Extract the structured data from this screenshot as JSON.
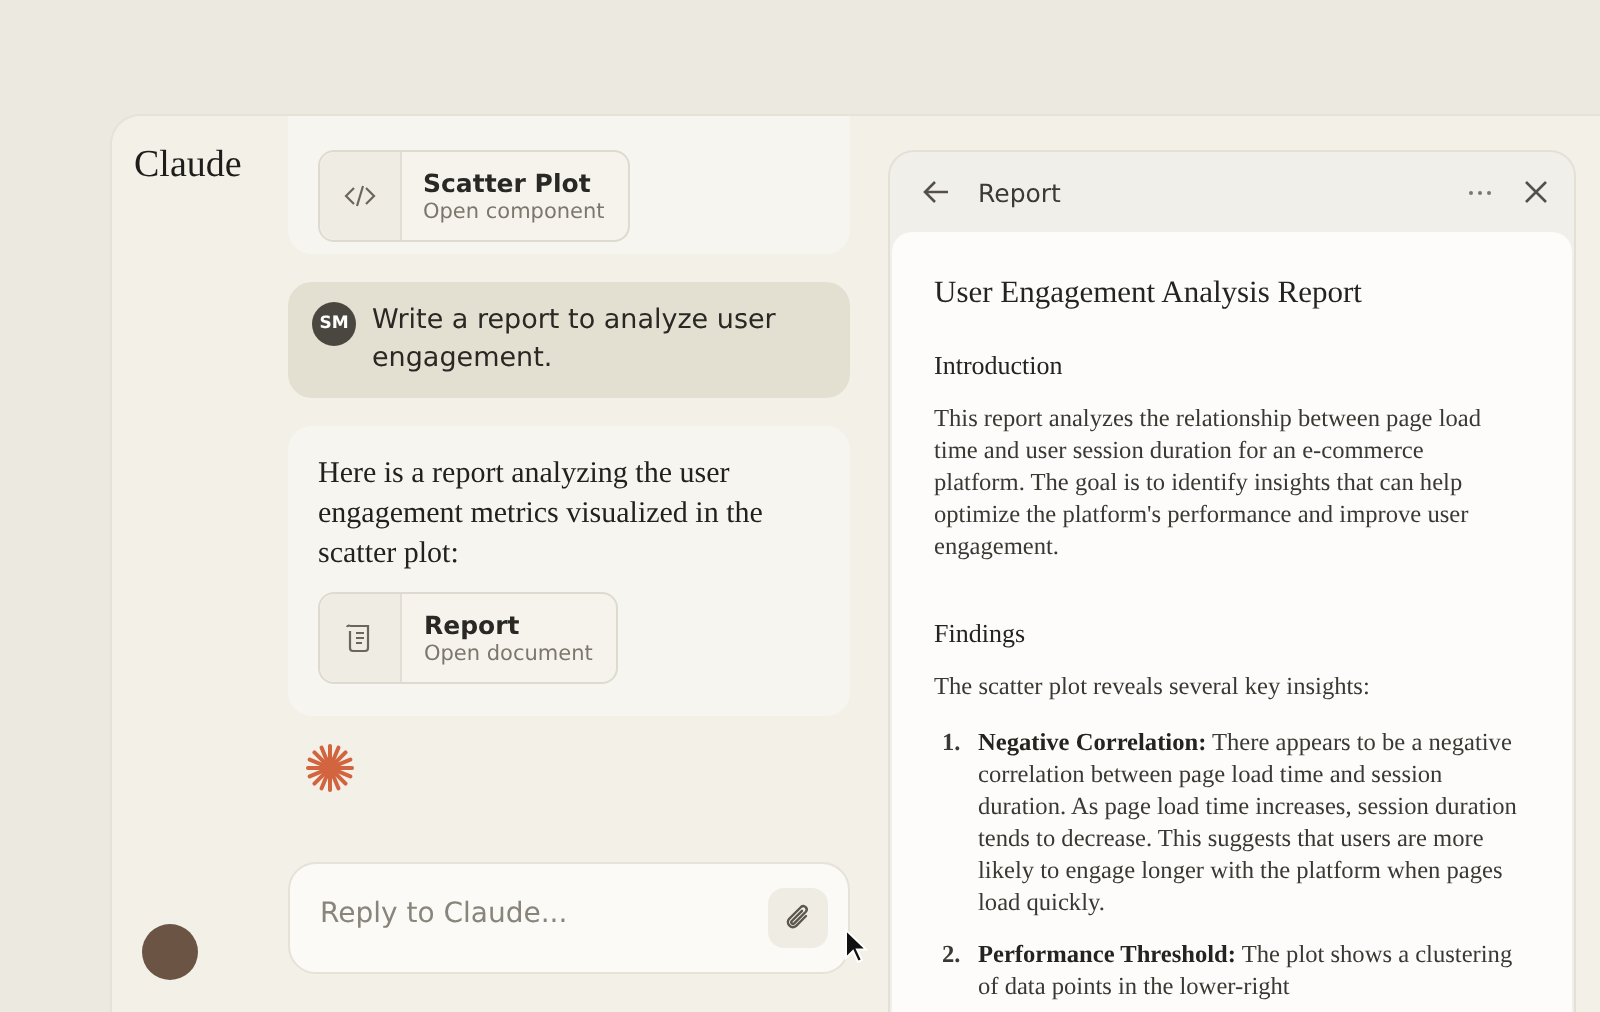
{
  "app": {
    "title": "Claude"
  },
  "chat": {
    "messages": [
      {
        "kind": "artifact",
        "artifact": {
          "kind": "code",
          "title": "Scatter Plot",
          "subtitle": "Open component"
        }
      },
      {
        "kind": "user",
        "initials": "SM",
        "text": "Write a report to analyze user engagement."
      },
      {
        "kind": "assistant",
        "text": "Here is a report analyzing the user engagement metrics visualized in the scatter plot:",
        "artifact": {
          "kind": "document",
          "title": "Report",
          "subtitle": "Open document"
        }
      }
    ],
    "composer": {
      "placeholder": "Reply to Claude..."
    }
  },
  "panel": {
    "title": "Report",
    "document": {
      "title": "User Engagement Analysis Report",
      "sections": [
        {
          "heading": "Introduction",
          "paragraph": "This report analyzes the relationship between page load time and user session duration for an e-commerce platform. The goal is to identify insights that can help optimize the platform's performance and improve user engagement."
        },
        {
          "heading": "Findings",
          "paragraph": "The scatter plot reveals several key insights:",
          "items": [
            {
              "number": "1.",
              "text": "**Negative Correlation:** There appears to be a negative correlation between page load time and session duration. As page load time increases, session duration tends to decrease. This suggests that users are more likely to engage longer with the platform when pages load quickly."
            },
            {
              "number": "2.",
              "text": "**Performance Threshold:** The plot shows a clustering of data points in the lower-right"
            }
          ]
        }
      ]
    }
  }
}
